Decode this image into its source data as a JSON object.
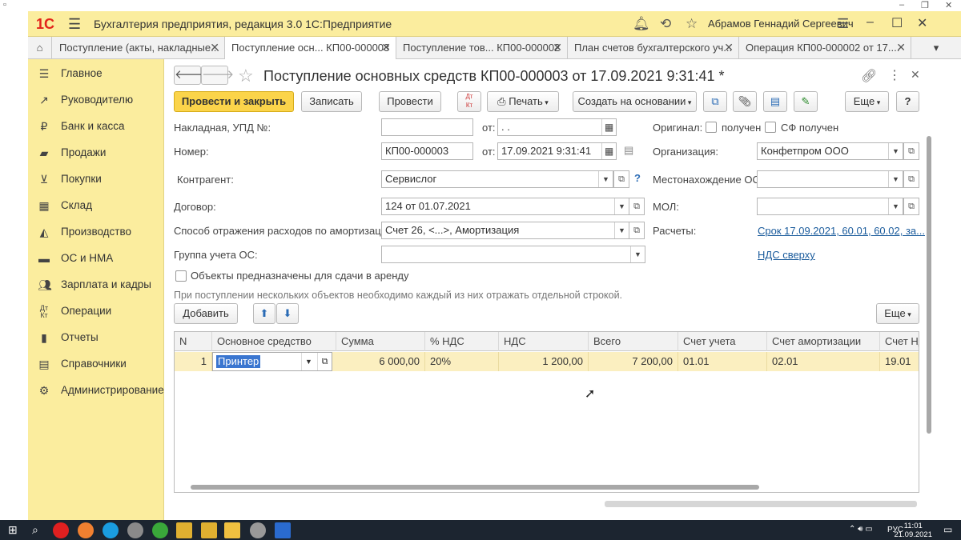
{
  "titlebar": {
    "logo": "1С",
    "title": "Бухгалтерия предприятия, редакция 3.0 1С:Предприятие",
    "user": "Абрамов Геннадий Сергеевич"
  },
  "tabs": [
    {
      "label": "Поступление (акты, накладные..."
    },
    {
      "label": "Поступление осн...  КП00-000003"
    },
    {
      "label": "Поступление тов...  КП00-000002"
    },
    {
      "label": "План счетов бухгалтерского уч..."
    },
    {
      "label": "Операция КП00-000002 от 17...."
    }
  ],
  "sidebar": {
    "items": [
      {
        "label": "Главное",
        "icon": "menu-icon"
      },
      {
        "label": "Руководителю",
        "icon": "trend-icon"
      },
      {
        "label": "Банк и касса",
        "icon": "coin-icon"
      },
      {
        "label": "Продажи",
        "icon": "bag-icon"
      },
      {
        "label": "Покупки",
        "icon": "cart-icon"
      },
      {
        "label": "Склад",
        "icon": "warehouse-icon"
      },
      {
        "label": "Производство",
        "icon": "factory-icon"
      },
      {
        "label": "ОС и НМА",
        "icon": "truck-icon"
      },
      {
        "label": "Зарплата и кадры",
        "icon": "people-icon"
      },
      {
        "label": "Операции",
        "icon": "dtkt-icon"
      },
      {
        "label": "Отчеты",
        "icon": "bar-chart-icon"
      },
      {
        "label": "Справочники",
        "icon": "book-icon"
      },
      {
        "label": "Администрирование",
        "icon": "gear-icon"
      }
    ]
  },
  "document": {
    "title": "Поступление основных средств КП00-000003 от 17.09.2021 9:31:41 *"
  },
  "toolbar": {
    "post_close": "Провести и закрыть",
    "save": "Записать",
    "post": "Провести",
    "print": "Печать",
    "create_based": "Создать на основании",
    "more": "Еще",
    "help": "?"
  },
  "form": {
    "invoice_label": "Накладная, УПД №:",
    "invoice_value": "",
    "from_label": "от:",
    "invoice_date": " .  .",
    "original_label": "Оригинал:",
    "received_label": "получен",
    "sf_received_label": "СФ получен",
    "number_label": "Номер:",
    "number_value": "КП00-000003",
    "number_date": "17.09.2021  9:31:41",
    "org_label": "Организация:",
    "org_value": "Конфетпром ООО",
    "contractor_label": "Контрагент:",
    "contractor_value": "Сервислог",
    "location_label": "Местонахождение ОС:",
    "location_value": "",
    "contract_label": "Договор:",
    "contract_value": "124 от 01.07.2021",
    "mol_label": "МОЛ:",
    "mol_value": "",
    "amort_label": "Способ отражения расходов по амортизации:",
    "amort_value": "Счет 26, <...>, Амортизация",
    "settlements_label": "Расчеты:",
    "settlements_link": "Срок 17.09.2021, 60.01, 60.02, за...",
    "group_label": "Группа учета ОС:",
    "group_value": "",
    "vat_link": "НДС сверху",
    "rent_label": "Объекты предназначены для сдачи в аренду",
    "hint": "При поступлении нескольких объектов необходимо каждый из них отражать отдельной строкой."
  },
  "table": {
    "add": "Добавить",
    "more": "Еще",
    "columns": [
      "N",
      "Основное средство",
      "Сумма",
      "% НДС",
      "НДС",
      "Всего",
      "Счет учета",
      "Счет амортизации",
      "Счет НДС"
    ],
    "rows": [
      {
        "n": "1",
        "asset": "Принтер",
        "sum": "6 000,00",
        "vat_rate": "20%",
        "vat": "1 200,00",
        "total": "7 200,00",
        "account": "01.01",
        "amort_account": "02.01",
        "vat_account": "19.01"
      }
    ]
  },
  "taskbar": {
    "lang": "РУС",
    "time": "11:01",
    "date": "21.09.2021"
  }
}
